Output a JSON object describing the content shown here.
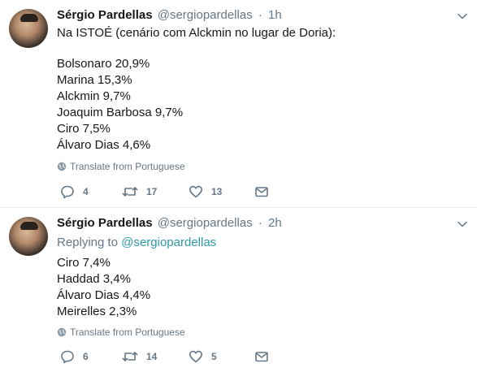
{
  "tweets": [
    {
      "name": "Sérgio Pardellas",
      "handle": "@sergiopardellas",
      "separator": "·",
      "time": "1h",
      "reply_prefix": "",
      "reply_handle": "",
      "lines": [
        "Na ISTOÉ (cenário com Alckmin no lugar de Doria):",
        "",
        "Bolsonaro 20,9%",
        "Marina 15,3%",
        "Alckmin 9,7%",
        "Joaquim Barbosa 9,7%",
        "Ciro 7,5%",
        "Álvaro Dias 4,6%"
      ],
      "translate": "Translate from Portuguese",
      "replies": "4",
      "retweets": "17",
      "likes": "13",
      "icons": {
        "reply": "reply-icon",
        "retweet": "retweet-icon",
        "like": "heart-icon",
        "dm": "envelope-icon",
        "menu": "chevron-down-icon",
        "translate": "globe-icon"
      }
    },
    {
      "name": "Sérgio Pardellas",
      "handle": "@sergiopardellas",
      "separator": "·",
      "time": "2h",
      "reply_prefix": "Replying to",
      "reply_handle": "@sergiopardellas",
      "lines": [
        "Ciro 7,4%",
        "Haddad 3,4%",
        "Álvaro Dias 4,4%",
        "Meirelles 2,3%"
      ],
      "translate": "Translate from Portuguese",
      "replies": "6",
      "retweets": "14",
      "likes": "5",
      "icons": {
        "reply": "reply-icon",
        "retweet": "retweet-icon",
        "like": "heart-icon",
        "dm": "envelope-icon",
        "menu": "chevron-down-icon",
        "translate": "globe-icon"
      }
    }
  ],
  "colors": {
    "text": "#14171a",
    "muted": "#657786",
    "link": "#2b9aa6",
    "divider": "#e6ecf0"
  }
}
